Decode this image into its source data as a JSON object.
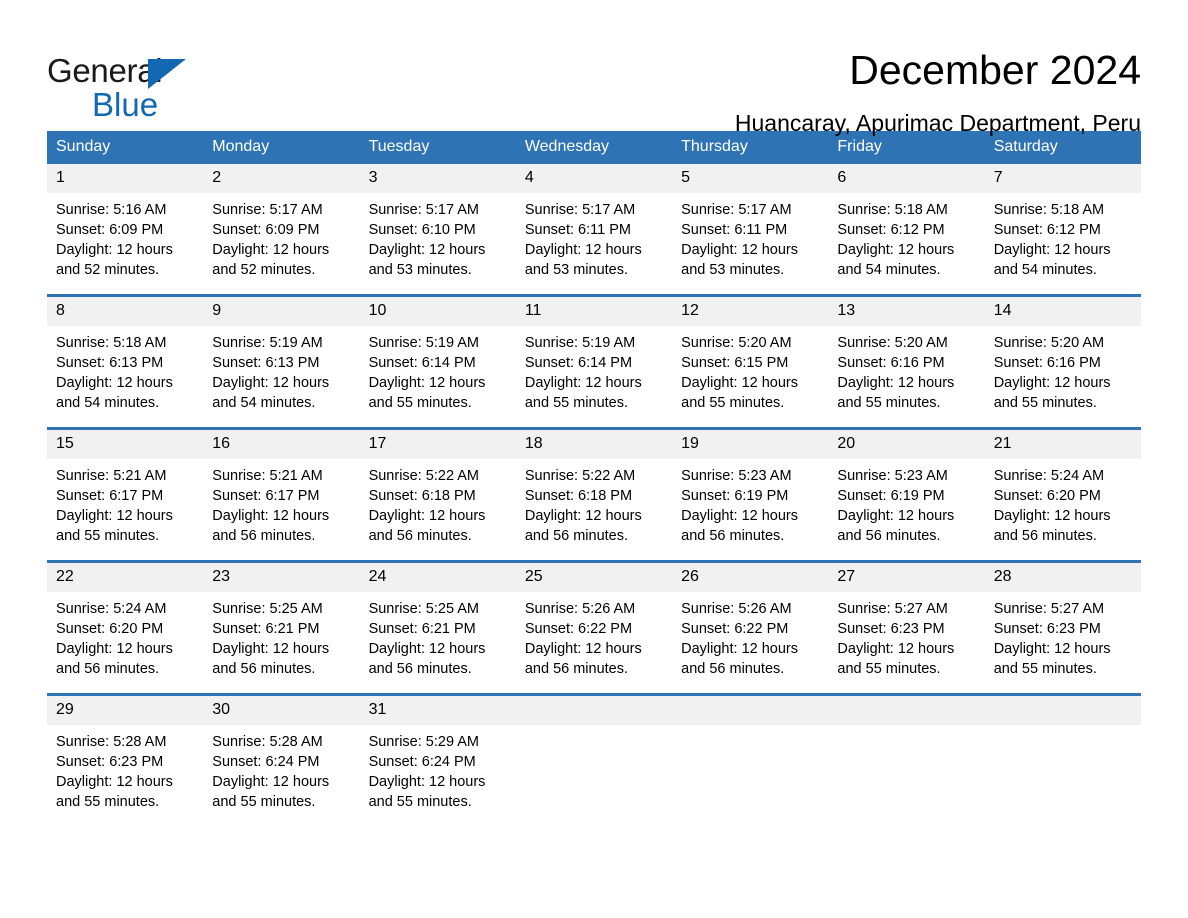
{
  "brand": {
    "name_part1": "General",
    "name_part2": "Blue",
    "accent_color": "#1268b3"
  },
  "header": {
    "month_title": "December 2024",
    "location_title": "Huancaray, Apurimac Department, Peru"
  },
  "theme": {
    "header_row_color": "#2e74b5",
    "daynum_band_color": "#f1f1f1",
    "text_color": "#000000"
  },
  "weekday_headers": [
    "Sunday",
    "Monday",
    "Tuesday",
    "Wednesday",
    "Thursday",
    "Friday",
    "Saturday"
  ],
  "weeks": [
    [
      {
        "day": "1",
        "sunrise": "Sunrise: 5:16 AM",
        "sunset": "Sunset: 6:09 PM",
        "daylight_line1": "Daylight: 12 hours",
        "daylight_line2": "and 52 minutes."
      },
      {
        "day": "2",
        "sunrise": "Sunrise: 5:17 AM",
        "sunset": "Sunset: 6:09 PM",
        "daylight_line1": "Daylight: 12 hours",
        "daylight_line2": "and 52 minutes."
      },
      {
        "day": "3",
        "sunrise": "Sunrise: 5:17 AM",
        "sunset": "Sunset: 6:10 PM",
        "daylight_line1": "Daylight: 12 hours",
        "daylight_line2": "and 53 minutes."
      },
      {
        "day": "4",
        "sunrise": "Sunrise: 5:17 AM",
        "sunset": "Sunset: 6:11 PM",
        "daylight_line1": "Daylight: 12 hours",
        "daylight_line2": "and 53 minutes."
      },
      {
        "day": "5",
        "sunrise": "Sunrise: 5:17 AM",
        "sunset": "Sunset: 6:11 PM",
        "daylight_line1": "Daylight: 12 hours",
        "daylight_line2": "and 53 minutes."
      },
      {
        "day": "6",
        "sunrise": "Sunrise: 5:18 AM",
        "sunset": "Sunset: 6:12 PM",
        "daylight_line1": "Daylight: 12 hours",
        "daylight_line2": "and 54 minutes."
      },
      {
        "day": "7",
        "sunrise": "Sunrise: 5:18 AM",
        "sunset": "Sunset: 6:12 PM",
        "daylight_line1": "Daylight: 12 hours",
        "daylight_line2": "and 54 minutes."
      }
    ],
    [
      {
        "day": "8",
        "sunrise": "Sunrise: 5:18 AM",
        "sunset": "Sunset: 6:13 PM",
        "daylight_line1": "Daylight: 12 hours",
        "daylight_line2": "and 54 minutes."
      },
      {
        "day": "9",
        "sunrise": "Sunrise: 5:19 AM",
        "sunset": "Sunset: 6:13 PM",
        "daylight_line1": "Daylight: 12 hours",
        "daylight_line2": "and 54 minutes."
      },
      {
        "day": "10",
        "sunrise": "Sunrise: 5:19 AM",
        "sunset": "Sunset: 6:14 PM",
        "daylight_line1": "Daylight: 12 hours",
        "daylight_line2": "and 55 minutes."
      },
      {
        "day": "11",
        "sunrise": "Sunrise: 5:19 AM",
        "sunset": "Sunset: 6:14 PM",
        "daylight_line1": "Daylight: 12 hours",
        "daylight_line2": "and 55 minutes."
      },
      {
        "day": "12",
        "sunrise": "Sunrise: 5:20 AM",
        "sunset": "Sunset: 6:15 PM",
        "daylight_line1": "Daylight: 12 hours",
        "daylight_line2": "and 55 minutes."
      },
      {
        "day": "13",
        "sunrise": "Sunrise: 5:20 AM",
        "sunset": "Sunset: 6:16 PM",
        "daylight_line1": "Daylight: 12 hours",
        "daylight_line2": "and 55 minutes."
      },
      {
        "day": "14",
        "sunrise": "Sunrise: 5:20 AM",
        "sunset": "Sunset: 6:16 PM",
        "daylight_line1": "Daylight: 12 hours",
        "daylight_line2": "and 55 minutes."
      }
    ],
    [
      {
        "day": "15",
        "sunrise": "Sunrise: 5:21 AM",
        "sunset": "Sunset: 6:17 PM",
        "daylight_line1": "Daylight: 12 hours",
        "daylight_line2": "and 55 minutes."
      },
      {
        "day": "16",
        "sunrise": "Sunrise: 5:21 AM",
        "sunset": "Sunset: 6:17 PM",
        "daylight_line1": "Daylight: 12 hours",
        "daylight_line2": "and 56 minutes."
      },
      {
        "day": "17",
        "sunrise": "Sunrise: 5:22 AM",
        "sunset": "Sunset: 6:18 PM",
        "daylight_line1": "Daylight: 12 hours",
        "daylight_line2": "and 56 minutes."
      },
      {
        "day": "18",
        "sunrise": "Sunrise: 5:22 AM",
        "sunset": "Sunset: 6:18 PM",
        "daylight_line1": "Daylight: 12 hours",
        "daylight_line2": "and 56 minutes."
      },
      {
        "day": "19",
        "sunrise": "Sunrise: 5:23 AM",
        "sunset": "Sunset: 6:19 PM",
        "daylight_line1": "Daylight: 12 hours",
        "daylight_line2": "and 56 minutes."
      },
      {
        "day": "20",
        "sunrise": "Sunrise: 5:23 AM",
        "sunset": "Sunset: 6:19 PM",
        "daylight_line1": "Daylight: 12 hours",
        "daylight_line2": "and 56 minutes."
      },
      {
        "day": "21",
        "sunrise": "Sunrise: 5:24 AM",
        "sunset": "Sunset: 6:20 PM",
        "daylight_line1": "Daylight: 12 hours",
        "daylight_line2": "and 56 minutes."
      }
    ],
    [
      {
        "day": "22",
        "sunrise": "Sunrise: 5:24 AM",
        "sunset": "Sunset: 6:20 PM",
        "daylight_line1": "Daylight: 12 hours",
        "daylight_line2": "and 56 minutes."
      },
      {
        "day": "23",
        "sunrise": "Sunrise: 5:25 AM",
        "sunset": "Sunset: 6:21 PM",
        "daylight_line1": "Daylight: 12 hours",
        "daylight_line2": "and 56 minutes."
      },
      {
        "day": "24",
        "sunrise": "Sunrise: 5:25 AM",
        "sunset": "Sunset: 6:21 PM",
        "daylight_line1": "Daylight: 12 hours",
        "daylight_line2": "and 56 minutes."
      },
      {
        "day": "25",
        "sunrise": "Sunrise: 5:26 AM",
        "sunset": "Sunset: 6:22 PM",
        "daylight_line1": "Daylight: 12 hours",
        "daylight_line2": "and 56 minutes."
      },
      {
        "day": "26",
        "sunrise": "Sunrise: 5:26 AM",
        "sunset": "Sunset: 6:22 PM",
        "daylight_line1": "Daylight: 12 hours",
        "daylight_line2": "and 56 minutes."
      },
      {
        "day": "27",
        "sunrise": "Sunrise: 5:27 AM",
        "sunset": "Sunset: 6:23 PM",
        "daylight_line1": "Daylight: 12 hours",
        "daylight_line2": "and 55 minutes."
      },
      {
        "day": "28",
        "sunrise": "Sunrise: 5:27 AM",
        "sunset": "Sunset: 6:23 PM",
        "daylight_line1": "Daylight: 12 hours",
        "daylight_line2": "and 55 minutes."
      }
    ],
    [
      {
        "day": "29",
        "sunrise": "Sunrise: 5:28 AM",
        "sunset": "Sunset: 6:23 PM",
        "daylight_line1": "Daylight: 12 hours",
        "daylight_line2": "and 55 minutes."
      },
      {
        "day": "30",
        "sunrise": "Sunrise: 5:28 AM",
        "sunset": "Sunset: 6:24 PM",
        "daylight_line1": "Daylight: 12 hours",
        "daylight_line2": "and 55 minutes."
      },
      {
        "day": "31",
        "sunrise": "Sunrise: 5:29 AM",
        "sunset": "Sunset: 6:24 PM",
        "daylight_line1": "Daylight: 12 hours",
        "daylight_line2": "and 55 minutes."
      },
      {
        "day": "",
        "sunrise": "",
        "sunset": "",
        "daylight_line1": "",
        "daylight_line2": ""
      },
      {
        "day": "",
        "sunrise": "",
        "sunset": "",
        "daylight_line1": "",
        "daylight_line2": ""
      },
      {
        "day": "",
        "sunrise": "",
        "sunset": "",
        "daylight_line1": "",
        "daylight_line2": ""
      },
      {
        "day": "",
        "sunrise": "",
        "sunset": "",
        "daylight_line1": "",
        "daylight_line2": ""
      }
    ]
  ]
}
